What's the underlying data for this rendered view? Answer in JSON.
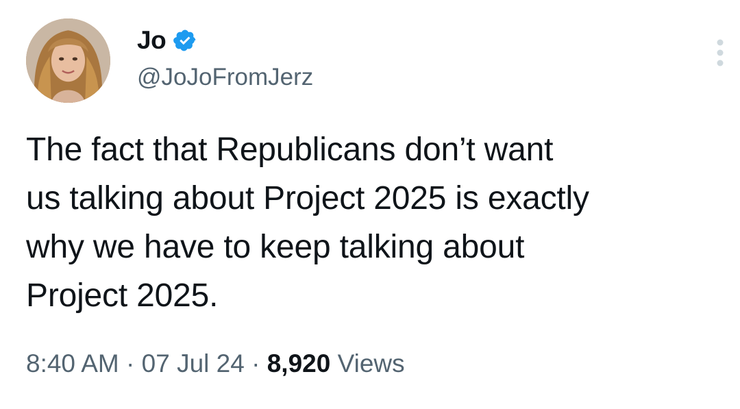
{
  "author": {
    "display_name": "Jo",
    "handle": "@JoJoFromJerz",
    "verified_icon": "verified-badge-icon",
    "avatar_icon": "profile-photo"
  },
  "tweet": {
    "text_lines": [
      "The fact that Republicans don’t want",
      "us talking about Project 2025 is exactly",
      "why we have to keep talking about",
      "Project 2025."
    ]
  },
  "meta": {
    "time": "8:40 AM",
    "separator": "·",
    "date": "07 Jul 24",
    "views_count": "8,920",
    "views_label": "Views"
  },
  "more_icon": "more-vertical-icon",
  "colors": {
    "text_primary": "#0f1419",
    "text_secondary": "#536471",
    "verified_blue": "#1d9bf0",
    "background": "#ffffff"
  }
}
